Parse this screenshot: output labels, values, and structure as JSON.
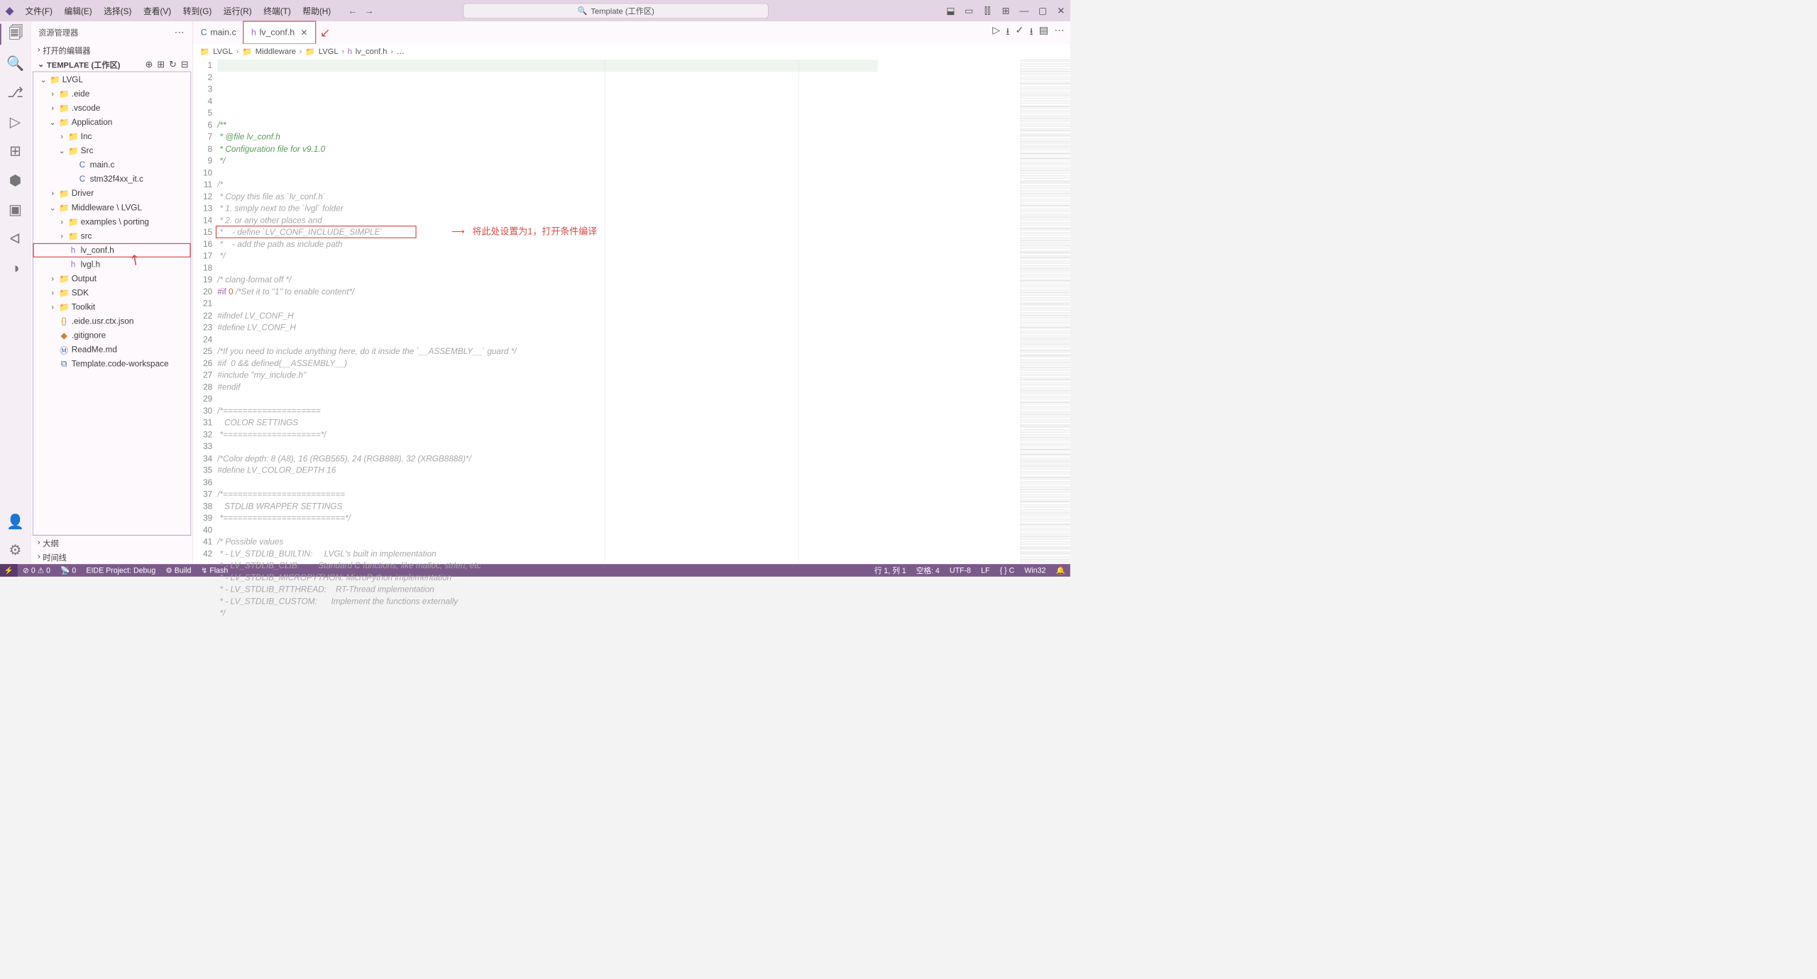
{
  "titlebar": {
    "menus": [
      "文件(F)",
      "编辑(E)",
      "选择(S)",
      "查看(V)",
      "转到(G)",
      "运行(R)",
      "终端(T)",
      "帮助(H)"
    ],
    "search_label": "Template (工作区)",
    "nav_back": "←",
    "nav_fwd": "→",
    "right_icons": [
      "⬓",
      "▭",
      "⫿⫿",
      "⊞",
      "—",
      "▢",
      "✕"
    ]
  },
  "activitybar": {
    "items": [
      "files",
      "search",
      "branch",
      "debug",
      "ext",
      "eide",
      "chip",
      "qa",
      "sync"
    ],
    "bottom": [
      "account",
      "settings"
    ]
  },
  "sidebar": {
    "title": "资源管理器",
    "sections": {
      "opened": "打开的编辑器",
      "workspace": "TEMPLATE (工作区)",
      "outline": "大纲",
      "timeline": "时间线"
    },
    "tools": [
      "⊕",
      "⊞",
      "↻",
      "⊟"
    ],
    "tree": [
      {
        "d": 0,
        "exp": 1,
        "ico": "📁",
        "cls": "fc-y",
        "label": "LVGL"
      },
      {
        "d": 1,
        "exp": 0,
        "ico": "📁",
        "cls": "fc-bl",
        "label": ".eide"
      },
      {
        "d": 1,
        "exp": 0,
        "ico": "📁",
        "cls": "fc-bl",
        "label": ".vscode"
      },
      {
        "d": 1,
        "exp": 1,
        "ico": "📁",
        "cls": "fc-gr",
        "label": "Application"
      },
      {
        "d": 2,
        "exp": 0,
        "ico": "📁",
        "cls": "fc-gr",
        "label": "Inc"
      },
      {
        "d": 2,
        "exp": 1,
        "ico": "📁",
        "cls": "fc-gr",
        "label": "Src"
      },
      {
        "d": 3,
        "ico": "C",
        "cls": "fc-bl",
        "label": "main.c"
      },
      {
        "d": 3,
        "ico": "C",
        "cls": "fc-bl",
        "label": "stm32f4xx_it.c"
      },
      {
        "d": 1,
        "exp": 0,
        "ico": "📁",
        "cls": "fc-gr",
        "label": "Driver"
      },
      {
        "d": 1,
        "exp": 1,
        "ico": "📁",
        "cls": "fc-gr",
        "label": "Middleware \\ LVGL"
      },
      {
        "d": 2,
        "exp": 0,
        "ico": "📁",
        "cls": "fc-gr",
        "label": "examples \\ porting"
      },
      {
        "d": 2,
        "exp": 0,
        "ico": "📁",
        "cls": "fc-gr",
        "label": "src"
      },
      {
        "d": 2,
        "ico": "h",
        "cls": "fc-pu",
        "label": "lv_conf.h",
        "sel": 1
      },
      {
        "d": 2,
        "ico": "h",
        "cls": "fc-pu",
        "label": "lvgl.h"
      },
      {
        "d": 1,
        "exp": 0,
        "ico": "📁",
        "cls": "fc-gr",
        "label": "Output"
      },
      {
        "d": 1,
        "exp": 0,
        "ico": "📁",
        "cls": "fc-gr",
        "label": "SDK"
      },
      {
        "d": 1,
        "exp": 0,
        "ico": "📁",
        "cls": "fc-gr",
        "label": "Toolkit"
      },
      {
        "d": 1,
        "ico": "{}",
        "cls": "fc-y",
        "label": ".eide.usr.ctx.json"
      },
      {
        "d": 1,
        "ico": "◆",
        "cls": "fc-or",
        "label": ".gitignore"
      },
      {
        "d": 1,
        "ico": "Ⓜ",
        "cls": "fc-bl",
        "label": "ReadMe.md"
      },
      {
        "d": 1,
        "ico": "⧉",
        "cls": "fc-bl",
        "label": "Template.code-workspace"
      }
    ]
  },
  "tabs": [
    {
      "ico": "C",
      "cls": "fc-bl",
      "label": "main.c"
    },
    {
      "ico": "h",
      "cls": "fc-pu",
      "label": "lv_conf.h",
      "act": 1,
      "close": 1
    }
  ],
  "runtools": [
    "▷",
    "⭳",
    "✓",
    "⭳",
    "▤",
    "⋯"
  ],
  "breadcrumbs": [
    "LVGL",
    "Middleware",
    "LVGL",
    "lv_conf.h",
    "…"
  ],
  "annotation": {
    "text": "将此处设置为1，打开条件编译",
    "arrow": "⟶"
  },
  "code": {
    "start": 1,
    "lines": [
      {
        "c": "cr-g",
        "t": "/**"
      },
      {
        "c": "cr-g",
        "t": " * @file lv_conf.h"
      },
      {
        "c": "cr-g",
        "t": " * Configuration file for v9.1.0"
      },
      {
        "c": "cr-g",
        "t": " */"
      },
      {
        "t": ""
      },
      {
        "c": "cr-gg",
        "t": "/*"
      },
      {
        "c": "cr-gg",
        "t": " * Copy this file as `lv_conf.h`"
      },
      {
        "c": "cr-gg",
        "t": " * 1. simply next to the `lvgl` folder"
      },
      {
        "c": "cr-gg",
        "t": " * 2. or any other places and"
      },
      {
        "c": "cr-gg",
        "t": " *    - define `LV_CONF_INCLUDE_SIMPLE`"
      },
      {
        "c": "cr-gg",
        "t": " *    - add the path as include path"
      },
      {
        "c": "cr-gg",
        "t": " */"
      },
      {
        "t": ""
      },
      {
        "c": "cr-gg",
        "t": "/* clang-format off */"
      },
      {
        "html": "<span class='cr-p'>#if</span> <span class='cr-n'>0</span> <span class='cr-gg'>/*Set it to \"1\" to enable content*/</span>",
        "box": 1
      },
      {
        "t": ""
      },
      {
        "c": "cr-gg",
        "t": "#ifndef LV_CONF_H"
      },
      {
        "c": "cr-gg",
        "t": "#define LV_CONF_H"
      },
      {
        "t": ""
      },
      {
        "c": "cr-gg",
        "t": "/*If you need to include anything here, do it inside the `__ASSEMBLY__` guard */"
      },
      {
        "c": "cr-gg",
        "t": "#if  0 && defined(__ASSEMBLY__)"
      },
      {
        "c": "cr-gg",
        "t": "#include \"my_include.h\""
      },
      {
        "c": "cr-gg",
        "t": "#endif"
      },
      {
        "t": ""
      },
      {
        "c": "cr-gg",
        "t": "/*===================="
      },
      {
        "c": "cr-gg",
        "t": "   COLOR SETTINGS"
      },
      {
        "c": "cr-gg",
        "t": " *====================*/"
      },
      {
        "t": ""
      },
      {
        "c": "cr-gg",
        "t": "/*Color depth: 8 (A8), 16 (RGB565), 24 (RGB888), 32 (XRGB8888)*/"
      },
      {
        "c": "cr-gg",
        "t": "#define LV_COLOR_DEPTH 16"
      },
      {
        "t": ""
      },
      {
        "c": "cr-gg",
        "t": "/*========================="
      },
      {
        "c": "cr-gg",
        "t": "   STDLIB WRAPPER SETTINGS"
      },
      {
        "c": "cr-gg",
        "t": " *=========================*/"
      },
      {
        "t": ""
      },
      {
        "c": "cr-gg",
        "t": "/* Possible values"
      },
      {
        "c": "cr-gg",
        "t": " * - LV_STDLIB_BUILTIN:     LVGL's built in implementation"
      },
      {
        "c": "cr-gg",
        "t": " * - LV_STDLIB_CLIB:        Standard C functions, like malloc, strlen, etc"
      },
      {
        "c": "cr-gg",
        "t": " * - LV_STDLIB_MICROPYTHON: MicroPython implementation"
      },
      {
        "c": "cr-gg",
        "t": " * - LV_STDLIB_RTTHREAD:    RT-Thread implementation"
      },
      {
        "c": "cr-gg",
        "t": " * - LV_STDLIB_CUSTOM:      Implement the functions externally"
      },
      {
        "c": "cr-gg",
        "t": " */"
      }
    ]
  },
  "status": {
    "remote": "⚡",
    "left": [
      "⊘ 0 ⚠ 0",
      "📡 0",
      "EIDE Project: Debug",
      "⚙ Build",
      "↯ Flash"
    ],
    "right": [
      "行 1, 列 1",
      "空格: 4",
      "UTF-8",
      "LF",
      "{ } C",
      "Win32",
      "🔔"
    ]
  }
}
